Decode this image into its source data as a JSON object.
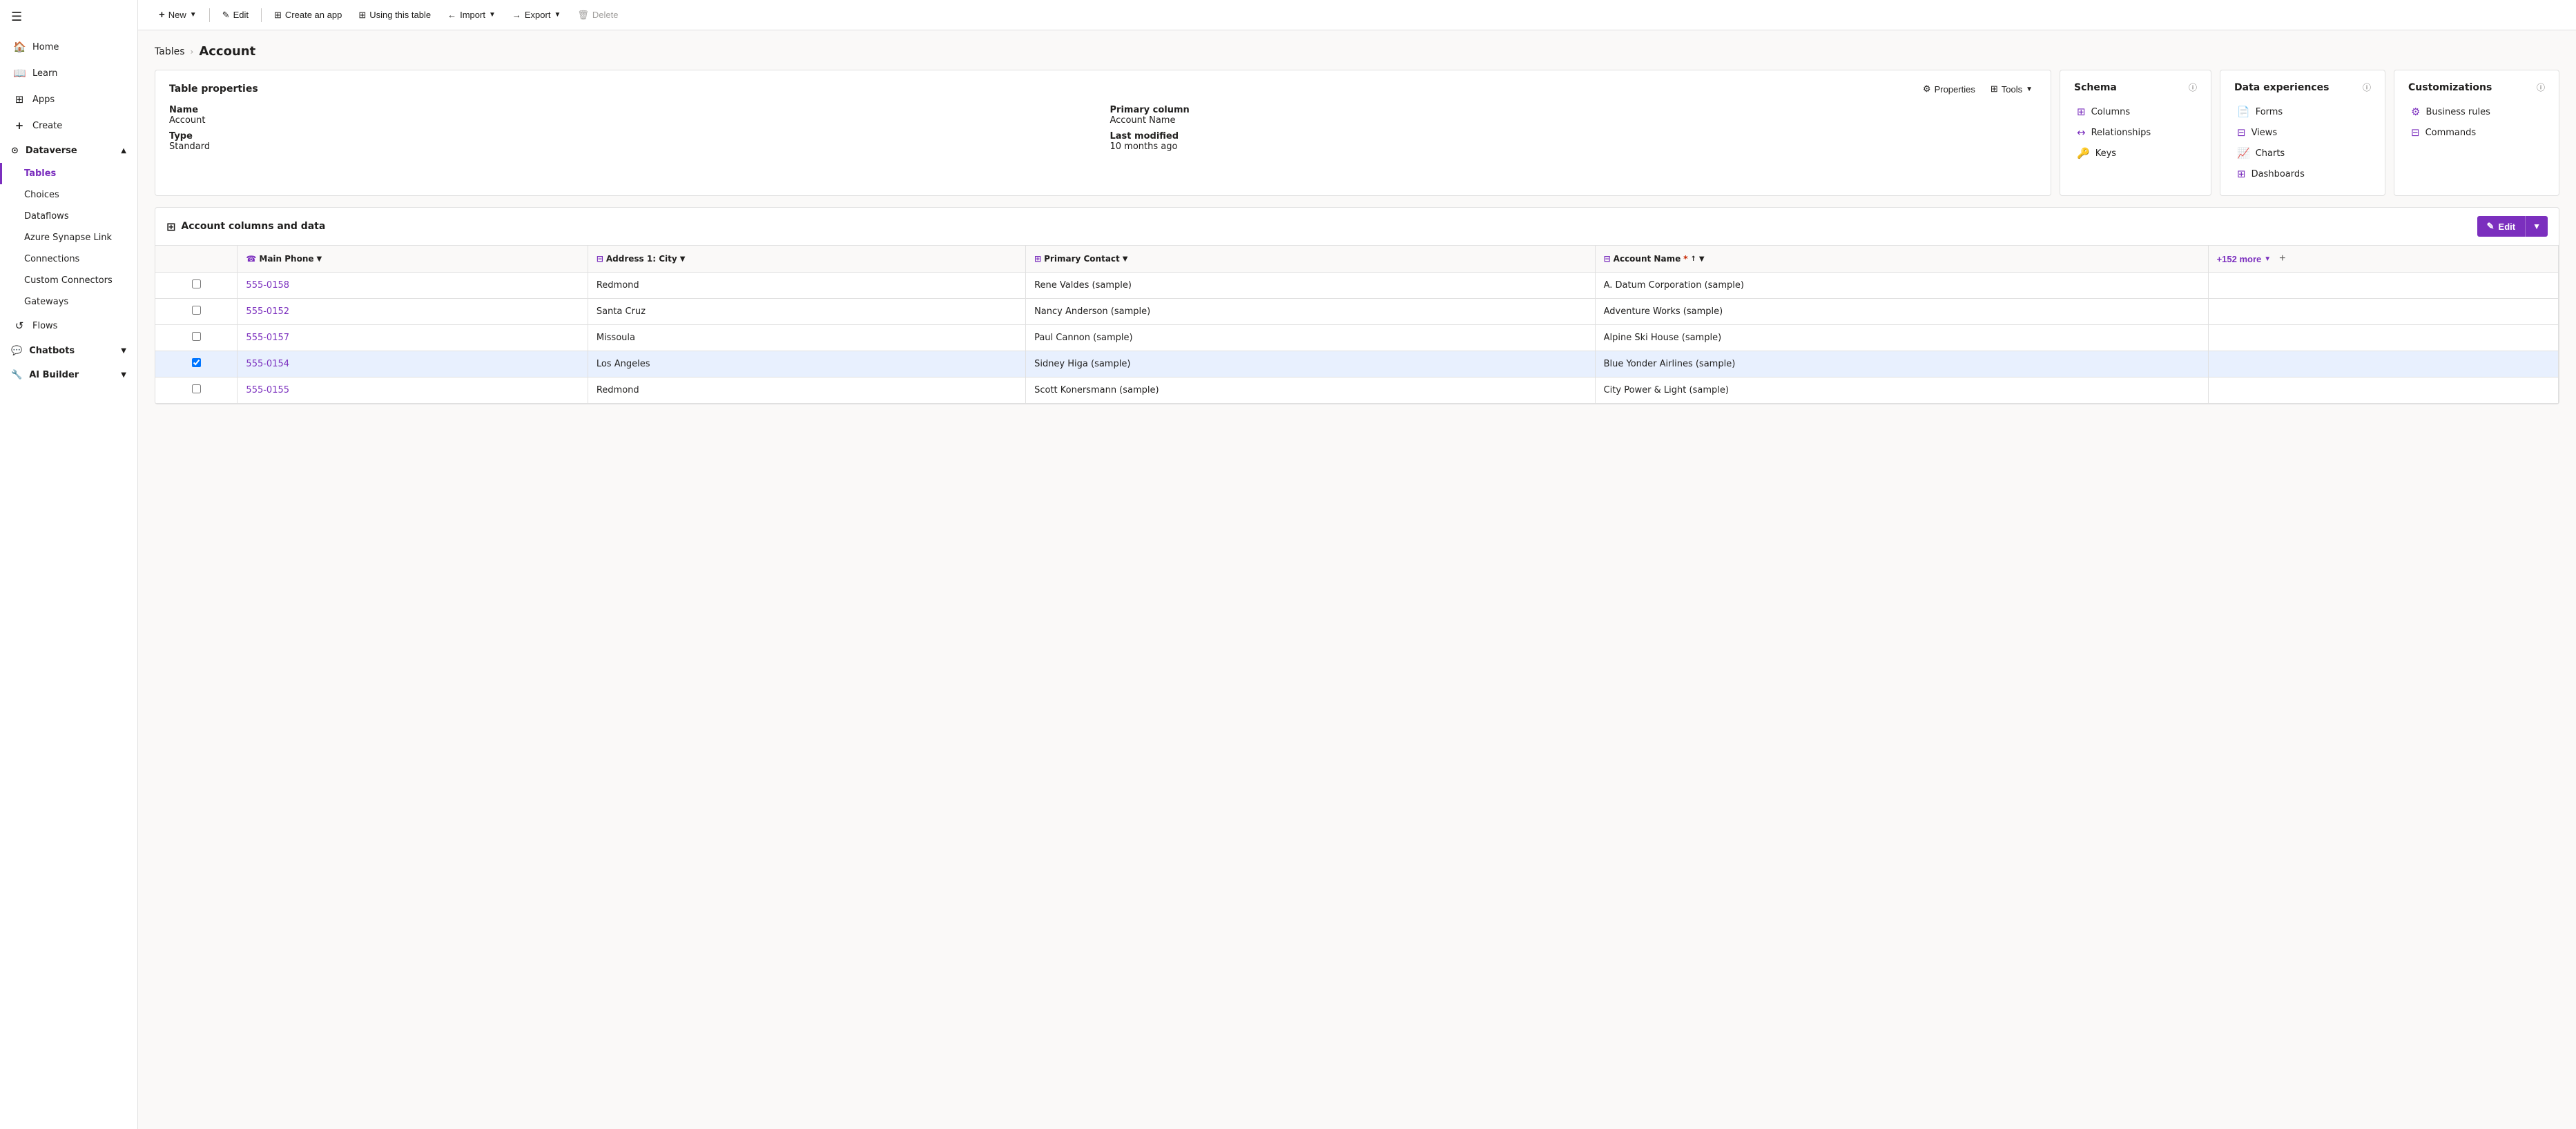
{
  "sidebar": {
    "hamburger_icon": "☰",
    "items": [
      {
        "id": "home",
        "label": "Home",
        "icon": "🏠",
        "active": false
      },
      {
        "id": "learn",
        "label": "Learn",
        "icon": "📖",
        "active": false
      },
      {
        "id": "apps",
        "label": "Apps",
        "icon": "⊞",
        "active": false
      },
      {
        "id": "create",
        "label": "Create",
        "icon": "+",
        "active": false
      }
    ],
    "dataverse_section": {
      "label": "Dataverse",
      "icon": "⊙",
      "expanded": true,
      "sub_items": [
        {
          "id": "tables",
          "label": "Tables",
          "active": true
        },
        {
          "id": "choices",
          "label": "Choices",
          "active": false
        },
        {
          "id": "dataflows",
          "label": "Dataflows",
          "active": false
        },
        {
          "id": "azure-synapse",
          "label": "Azure Synapse Link",
          "active": false
        },
        {
          "id": "connections",
          "label": "Connections",
          "active": false
        },
        {
          "id": "custom-connectors",
          "label": "Custom Connectors",
          "active": false
        },
        {
          "id": "gateways",
          "label": "Gateways",
          "active": false
        }
      ]
    },
    "flows_item": {
      "id": "flows",
      "label": "Flows",
      "icon": "↺",
      "active": false
    },
    "chatbots_item": {
      "id": "chatbots",
      "label": "Chatbots",
      "icon": "💬",
      "active": false,
      "expanded": false
    },
    "ai_builder_item": {
      "id": "ai-builder",
      "label": "AI Builder",
      "icon": "🔧",
      "active": false,
      "expanded": false
    }
  },
  "toolbar": {
    "new_label": "New",
    "edit_label": "Edit",
    "create_app_label": "Create an app",
    "using_this_table_label": "Using this table",
    "import_label": "Import",
    "export_label": "Export",
    "delete_label": "Delete",
    "new_icon": "+",
    "edit_icon": "✎",
    "create_app_icon": "⊞",
    "using_icon": "⊞",
    "import_icon": "←",
    "export_icon": "→",
    "delete_icon": "🗑"
  },
  "breadcrumb": {
    "parent_label": "Tables",
    "separator": "›",
    "current_label": "Account"
  },
  "table_properties_card": {
    "title": "Table properties",
    "properties_btn": "Properties",
    "tools_btn": "Tools",
    "properties_icon": "⚙",
    "tools_icon": "⊞",
    "rows": [
      {
        "label": "Name",
        "bold": true,
        "value": ""
      },
      {
        "label": "Account",
        "bold": false,
        "value": ""
      },
      {
        "label": "Type",
        "bold": true,
        "value": ""
      },
      {
        "label": "Standard",
        "bold": false,
        "value": ""
      }
    ],
    "primary_col": {
      "label": "Primary column",
      "value": "Account Name"
    },
    "last_modified": {
      "label": "Last modified",
      "value": "10 months ago"
    },
    "name_label": "Name",
    "name_value": "Account",
    "type_label": "Type",
    "type_value": "Standard",
    "primary_column_label": "Primary column",
    "primary_column_value": "Account Name",
    "last_modified_label": "Last modified",
    "last_modified_value": "10 months ago"
  },
  "schema_card": {
    "title": "Schema",
    "info_icon": "ⓘ",
    "links": [
      {
        "id": "columns",
        "label": "Columns",
        "icon": "⊞"
      },
      {
        "id": "relationships",
        "label": "Relationships",
        "icon": "↔"
      },
      {
        "id": "keys",
        "label": "Keys",
        "icon": "🔑"
      }
    ]
  },
  "data_experiences_card": {
    "title": "Data experiences",
    "info_icon": "ⓘ",
    "links": [
      {
        "id": "forms",
        "label": "Forms",
        "icon": "📄"
      },
      {
        "id": "views",
        "label": "Views",
        "icon": "⊟"
      },
      {
        "id": "charts",
        "label": "Charts",
        "icon": "📈"
      },
      {
        "id": "dashboards",
        "label": "Dashboards",
        "icon": "⊞"
      }
    ]
  },
  "customizations_card": {
    "title": "Customizations",
    "info_icon": "ⓘ",
    "links": [
      {
        "id": "business-rules",
        "label": "Business rules",
        "icon": "⚙"
      },
      {
        "id": "commands",
        "label": "Commands",
        "icon": "⊟"
      }
    ]
  },
  "data_table": {
    "section_title": "Account columns and data",
    "section_icon": "⊞",
    "edit_btn_label": "Edit",
    "edit_icon": "✎",
    "columns": [
      {
        "id": "main-phone",
        "label": "Main Phone",
        "icon": "☎",
        "sortable": true,
        "dropdown": true
      },
      {
        "id": "address-city",
        "label": "Address 1: City",
        "icon": "⊟",
        "sortable": false,
        "dropdown": true
      },
      {
        "id": "primary-contact",
        "label": "Primary Contact",
        "icon": "⊞",
        "sortable": false,
        "dropdown": true
      },
      {
        "id": "account-name",
        "label": "Account Name",
        "icon": "⊟",
        "required": true,
        "sortable": true,
        "sort_dir": "asc",
        "dropdown": true
      }
    ],
    "more_cols_label": "+152 more",
    "rows": [
      {
        "id": 1,
        "main_phone": "555-0158",
        "city": "Redmond",
        "primary_contact": "Rene Valdes (sample)",
        "account_name": "A. Datum Corporation (sample)",
        "selected": false
      },
      {
        "id": 2,
        "main_phone": "555-0152",
        "city": "Santa Cruz",
        "primary_contact": "Nancy Anderson (sample)",
        "account_name": "Adventure Works (sample)",
        "selected": false
      },
      {
        "id": 3,
        "main_phone": "555-0157",
        "city": "Missoula",
        "primary_contact": "Paul Cannon (sample)",
        "account_name": "Alpine Ski House (sample)",
        "selected": false
      },
      {
        "id": 4,
        "main_phone": "555-0154",
        "city": "Los Angeles",
        "primary_contact": "Sidney Higa (sample)",
        "account_name": "Blue Yonder Airlines (sample)",
        "selected": true
      },
      {
        "id": 5,
        "main_phone": "555-0155",
        "city": "Redmond",
        "primary_contact": "Scott Konersmann (sample)",
        "account_name": "City Power & Light (sample)",
        "selected": false
      }
    ]
  }
}
